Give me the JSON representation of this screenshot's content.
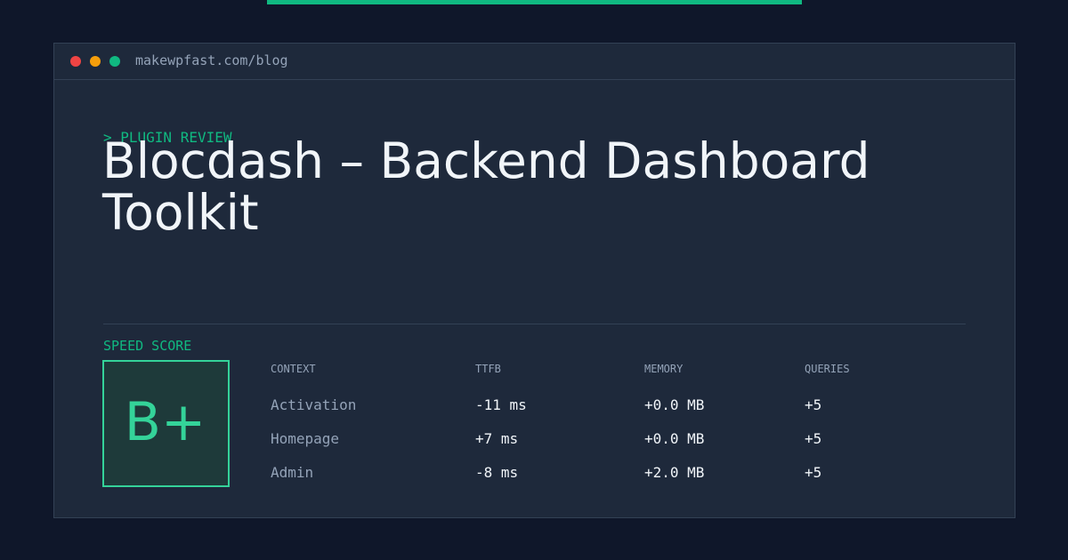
{
  "browser": {
    "url": "makewpfast.com/blog"
  },
  "post": {
    "eyebrow": "> PLUGIN REVIEW",
    "title": "Blocdash – Backend Dashboard Toolkit"
  },
  "speed": {
    "label": "SPEED SCORE",
    "grade": "B+"
  },
  "table": {
    "headers": [
      "CONTEXT",
      "TTFB",
      "MEMORY",
      "QUERIES"
    ],
    "rows": [
      [
        "Activation",
        "-11 ms",
        "+0.0 MB",
        "+5"
      ],
      [
        "Homepage",
        "+7 ms",
        "+0.0 MB",
        "+5"
      ],
      [
        "Admin",
        "-8 ms",
        "+2.0 MB",
        "+5"
      ]
    ]
  },
  "colors": {
    "background": "#0f172a",
    "card": "#1e293b",
    "accent": "#10b981",
    "grade": "#34d399",
    "text": "#f1f5f9",
    "muted": "#94a3b8"
  },
  "icons": [
    "close-dot-icon",
    "minimize-dot-icon",
    "maximize-dot-icon"
  ]
}
